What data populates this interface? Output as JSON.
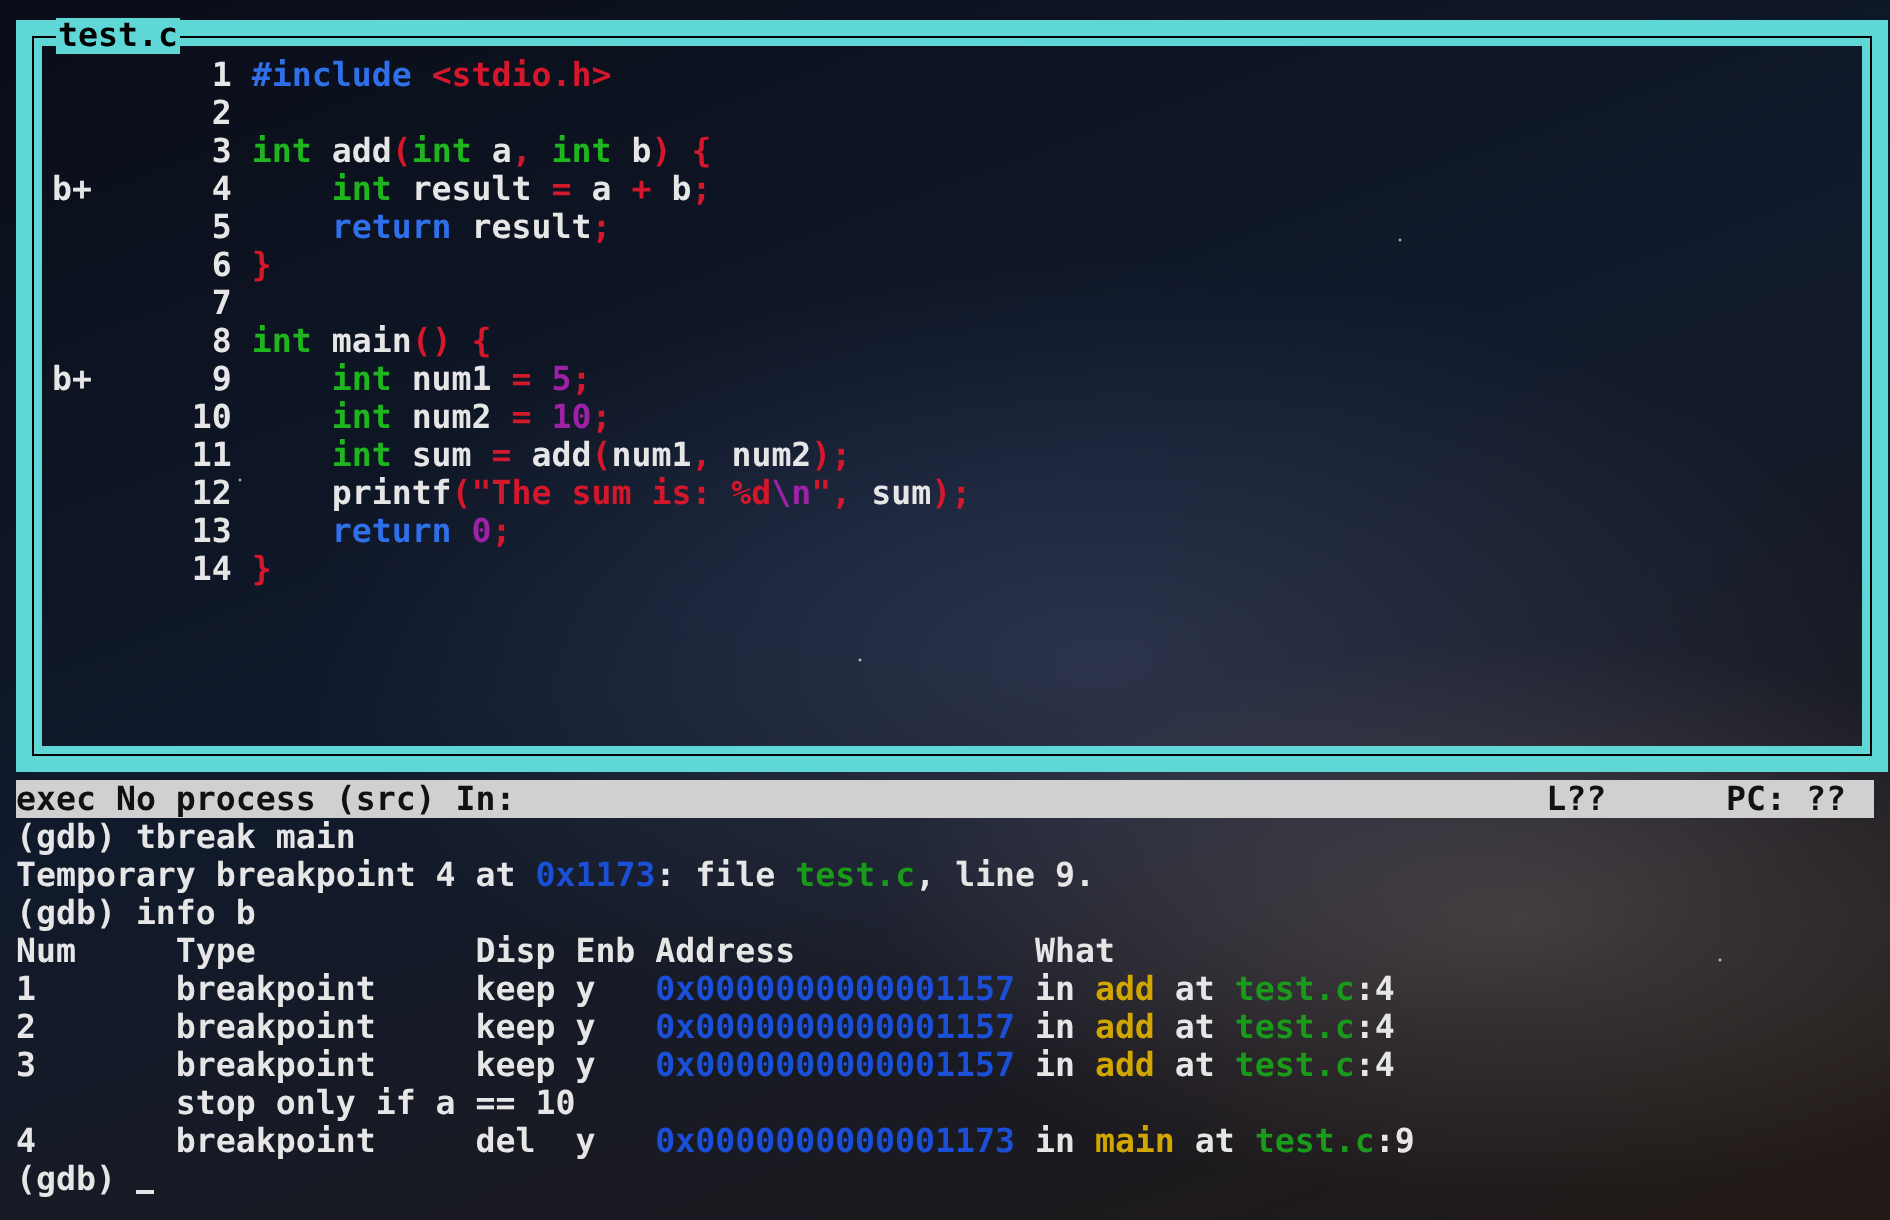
{
  "source_window": {
    "title": "test.c",
    "lines": [
      {
        "number": "1",
        "tokens": [
          {
            "text": "#include ",
            "kind": "preproc"
          },
          {
            "text": "<stdio.h>",
            "kind": "string"
          }
        ]
      },
      {
        "number": "2"
      },
      {
        "number": "3",
        "tokens": [
          {
            "text": "int",
            "kind": "type"
          },
          {
            "text": " add",
            "kind": "plain"
          },
          {
            "text": "(",
            "kind": "punct"
          },
          {
            "text": "int",
            "kind": "type"
          },
          {
            "text": " a",
            "kind": "plain"
          },
          {
            "text": ",",
            "kind": "punct"
          },
          {
            "text": " int",
            "kind": "type"
          },
          {
            "text": " b",
            "kind": "plain"
          },
          {
            "text": ")",
            "kind": "punct"
          },
          {
            "text": " {",
            "kind": "punct"
          }
        ]
      },
      {
        "marker": "b+",
        "number": "4",
        "tokens": [
          {
            "text": "    int",
            "kind": "type"
          },
          {
            "text": " result ",
            "kind": "plain"
          },
          {
            "text": "=",
            "kind": "punct"
          },
          {
            "text": " a ",
            "kind": "plain"
          },
          {
            "text": "+",
            "kind": "punct"
          },
          {
            "text": " b",
            "kind": "plain"
          },
          {
            "text": ";",
            "kind": "punct"
          }
        ]
      },
      {
        "number": "5",
        "tokens": [
          {
            "text": "    return",
            "kind": "control"
          },
          {
            "text": " result",
            "kind": "plain"
          },
          {
            "text": ";",
            "kind": "punct"
          }
        ]
      },
      {
        "number": "6",
        "tokens": [
          {
            "text": "}",
            "kind": "punct"
          }
        ]
      },
      {
        "number": "7"
      },
      {
        "number": "8",
        "tokens": [
          {
            "text": "int",
            "kind": "type"
          },
          {
            "text": " main",
            "kind": "plain"
          },
          {
            "text": "()",
            "kind": "punct"
          },
          {
            "text": " {",
            "kind": "punct"
          }
        ]
      },
      {
        "marker": "b+",
        "number": "9",
        "tokens": [
          {
            "text": "    int",
            "kind": "type"
          },
          {
            "text": " num1 ",
            "kind": "plain"
          },
          {
            "text": "=",
            "kind": "punct"
          },
          {
            "text": " 5",
            "kind": "number"
          },
          {
            "text": ";",
            "kind": "punct"
          }
        ]
      },
      {
        "number": "10",
        "tokens": [
          {
            "text": "    int",
            "kind": "type"
          },
          {
            "text": " num2 ",
            "kind": "plain"
          },
          {
            "text": "=",
            "kind": "punct"
          },
          {
            "text": " 10",
            "kind": "number"
          },
          {
            "text": ";",
            "kind": "punct"
          }
        ]
      },
      {
        "number": "11",
        "tokens": [
          {
            "text": "    int",
            "kind": "type"
          },
          {
            "text": " sum ",
            "kind": "plain"
          },
          {
            "text": "=",
            "kind": "punct"
          },
          {
            "text": " add",
            "kind": "plain"
          },
          {
            "text": "(",
            "kind": "punct"
          },
          {
            "text": "num1",
            "kind": "plain"
          },
          {
            "text": ",",
            "kind": "punct"
          },
          {
            "text": " num2",
            "kind": "plain"
          },
          {
            "text": ")",
            "kind": "punct"
          },
          {
            "text": ";",
            "kind": "punct"
          }
        ]
      },
      {
        "number": "12",
        "tokens": [
          {
            "text": "    printf",
            "kind": "plain"
          },
          {
            "text": "(",
            "kind": "punct"
          },
          {
            "text": "\"The sum is: %d",
            "kind": "string"
          },
          {
            "text": "\\n",
            "kind": "escape"
          },
          {
            "text": "\"",
            "kind": "string"
          },
          {
            "text": ",",
            "kind": "punct"
          },
          {
            "text": " sum",
            "kind": "plain"
          },
          {
            "text": ")",
            "kind": "punct"
          },
          {
            "text": ";",
            "kind": "punct"
          }
        ]
      },
      {
        "number": "13",
        "tokens": [
          {
            "text": "    return",
            "kind": "control"
          },
          {
            "text": " 0",
            "kind": "number"
          },
          {
            "text": ";",
            "kind": "punct"
          }
        ]
      },
      {
        "number": "14",
        "tokens": [
          {
            "text": "}",
            "kind": "punct"
          }
        ]
      }
    ]
  },
  "status_bar": {
    "text": "exec No process (src) In:",
    "line": "L??",
    "pc": "PC: ??"
  },
  "console": {
    "lines": [
      {
        "tokens": [
          {
            "text": "(gdb) tbreak main",
            "kind": "plain"
          }
        ]
      },
      {
        "tokens": [
          {
            "text": "Temporary breakpoint 4 at ",
            "kind": "plain"
          },
          {
            "text": "0x1173",
            "kind": "address"
          },
          {
            "text": ": file ",
            "kind": "plain"
          },
          {
            "text": "test.c",
            "kind": "file"
          },
          {
            "text": ", line 9.",
            "kind": "plain"
          }
        ]
      },
      {
        "tokens": [
          {
            "text": "(gdb) info b",
            "kind": "plain"
          }
        ]
      }
    ],
    "table": {
      "columns": [
        "Num",
        "Type",
        "Disp",
        "Enb",
        "Address",
        "What"
      ],
      "rows": [
        {
          "kind": "breakpoint",
          "num": "1",
          "type": "breakpoint",
          "disp": "keep",
          "enb": "y",
          "address": "0x0000000000001157",
          "what": [
            {
              "text": "in ",
              "kind": "plain"
            },
            {
              "text": "add",
              "kind": "function"
            },
            {
              "text": " at ",
              "kind": "plain"
            },
            {
              "text": "test.c",
              "kind": "file"
            },
            {
              "text": ":4",
              "kind": "plain"
            }
          ]
        },
        {
          "kind": "breakpoint",
          "num": "2",
          "type": "breakpoint",
          "disp": "keep",
          "enb": "y",
          "address": "0x0000000000001157",
          "what": [
            {
              "text": "in ",
              "kind": "plain"
            },
            {
              "text": "add",
              "kind": "function"
            },
            {
              "text": " at ",
              "kind": "plain"
            },
            {
              "text": "test.c",
              "kind": "file"
            },
            {
              "text": ":4",
              "kind": "plain"
            }
          ]
        },
        {
          "kind": "breakpoint",
          "num": "3",
          "type": "breakpoint",
          "disp": "keep",
          "enb": "y",
          "address": "0x0000000000001157",
          "what": [
            {
              "text": "in ",
              "kind": "plain"
            },
            {
              "text": "add",
              "kind": "function"
            },
            {
              "text": " at ",
              "kind": "plain"
            },
            {
              "text": "test.c",
              "kind": "file"
            },
            {
              "text": ":4",
              "kind": "plain"
            }
          ]
        },
        {
          "kind": "condition",
          "text": "stop only if a == 10"
        },
        {
          "kind": "breakpoint",
          "num": "4",
          "type": "breakpoint",
          "disp": "del",
          "enb": "y",
          "address": "0x0000000000001173",
          "what": [
            {
              "text": "in ",
              "kind": "plain"
            },
            {
              "text": "main",
              "kind": "function"
            },
            {
              "text": " at ",
              "kind": "plain"
            },
            {
              "text": "test.c",
              "kind": "file"
            },
            {
              "text": ":9",
              "kind": "plain"
            }
          ]
        }
      ]
    },
    "prompt": "(gdb)"
  }
}
